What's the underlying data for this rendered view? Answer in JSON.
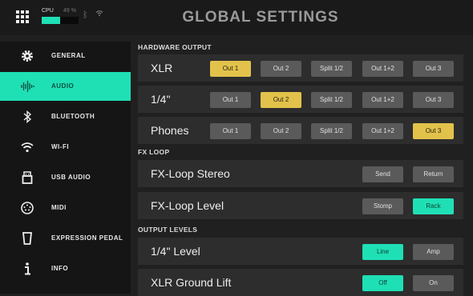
{
  "header": {
    "title": "GLOBAL SETTINGS",
    "cpu_label": "CPU",
    "cpu_percent_text": "49 %",
    "cpu_load": 0.49,
    "icons": [
      "grid-menu-icon",
      "bluetooth-icon",
      "wifi-icon"
    ]
  },
  "sidebar": {
    "items": [
      {
        "label": "GENERAL",
        "icon": "gear-icon",
        "glyph": "⚙"
      },
      {
        "label": "AUDIO",
        "icon": "audio-waveform-icon",
        "glyph": "",
        "active": true
      },
      {
        "label": "BLUETOOTH",
        "icon": "bluetooth-icon",
        "glyph": "ᛒ"
      },
      {
        "label": "WI-FI",
        "icon": "wifi-icon",
        "glyph": ""
      },
      {
        "label": "USB AUDIO",
        "icon": "usb-icon",
        "glyph": ""
      },
      {
        "label": "MIDI",
        "icon": "midi-port-icon",
        "glyph": ""
      },
      {
        "label": "EXPRESSION PEDAL",
        "icon": "expression-pedal-icon",
        "glyph": ""
      },
      {
        "label": "INFO",
        "icon": "info-icon",
        "glyph": ""
      }
    ]
  },
  "sections": {
    "hardware_output": "HARDWARE OUTPUT",
    "fx_loop": "FX LOOP",
    "output_levels": "OUTPUT LEVELS"
  },
  "hardware_output": {
    "rows": [
      {
        "label": "XLR",
        "options": [
          "Out 1",
          "Out 2",
          "Split 1/2",
          "Out 1+2",
          "Out 3"
        ],
        "selected": "Out 1"
      },
      {
        "label": "1/4\"",
        "options": [
          "Out 1",
          "Out 2",
          "Split 1/2",
          "Out 1+2",
          "Out 3"
        ],
        "selected": "Out 2"
      },
      {
        "label": "Phones",
        "options": [
          "Out 1",
          "Out 2",
          "Split 1/2",
          "Out 1+2",
          "Out 3"
        ],
        "selected": "Out 3"
      }
    ]
  },
  "fx_loop": {
    "rows": [
      {
        "label": "FX-Loop Stereo",
        "options": [
          "Send",
          "Return"
        ],
        "selected": null
      },
      {
        "label": "FX-Loop Level",
        "options": [
          "Stomp",
          "Rack"
        ],
        "selected": "Rack"
      }
    ]
  },
  "output_levels": {
    "rows": [
      {
        "label": "1/4\" Level",
        "options": [
          "Line",
          "Amp"
        ],
        "selected": "Line"
      },
      {
        "label": "XLR Ground Lift",
        "options": [
          "Off",
          "On"
        ],
        "selected": "Off"
      }
    ]
  },
  "colors": {
    "accent_teal": "#1fe0b5",
    "selected_yellow": "#e2c24b",
    "button_gray": "#5a5a5a"
  }
}
